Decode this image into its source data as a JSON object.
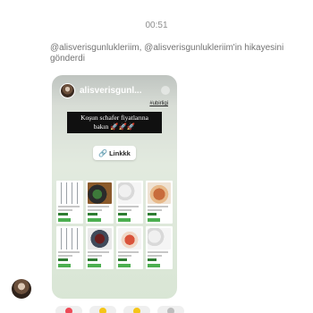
{
  "chat": {
    "timestamp": "00:51",
    "share_text": "@alisverisgunlukleriim, @alisverisgunlukleriim'in hikayesini gönderdi"
  },
  "story": {
    "username": "alisverisgunl...",
    "tag": "#ubirligi",
    "banner_line1": "Koşun schafer fiyatlarına",
    "banner_line2": "bakın 🚀🚀🚀",
    "link_label": "Linkkk",
    "link_icon": "link-icon",
    "products": [
      {
        "image": "cutlery"
      },
      {
        "image": "food"
      },
      {
        "image": "set"
      },
      {
        "image": "cake"
      },
      {
        "image": "cutlery"
      },
      {
        "image": "bowl"
      },
      {
        "image": "dessert"
      },
      {
        "image": "set"
      }
    ]
  },
  "reactions": [
    {
      "icon": "heart-icon",
      "color": "#ed4956"
    },
    {
      "icon": "emoji-icon",
      "color": "#f5c518"
    },
    {
      "icon": "emoji-icon",
      "color": "#f5c518"
    },
    {
      "icon": "more-icon",
      "color": "#bdbdbd"
    }
  ]
}
